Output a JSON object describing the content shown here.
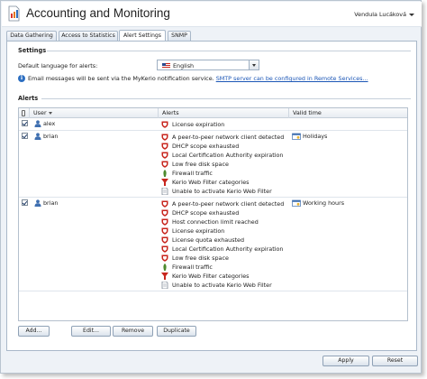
{
  "app": {
    "title": "Accounting and Monitoring",
    "user": "Vendula Lucáková"
  },
  "tabs": [
    {
      "label": "Data Gathering",
      "active": false
    },
    {
      "label": "Access to Statistics",
      "active": false
    },
    {
      "label": "Alert Settings",
      "active": true
    },
    {
      "label": "SNMP",
      "active": false
    }
  ],
  "settings": {
    "group_title": "Settings",
    "language_label": "Default language for alerts:",
    "language_value": "English",
    "info_text": "Email messages will be sent via the MyKerio notification service.",
    "info_link": "SMTP server can be configured in Remote Services..."
  },
  "alerts": {
    "group_title": "Alerts",
    "columns": {
      "user": "User",
      "alerts": "Alerts",
      "valid_time": "Valid time"
    },
    "rows": [
      {
        "user": "alex",
        "checked": true,
        "alerts": [
          "License expiration"
        ],
        "valid_time": ""
      },
      {
        "user": "brian",
        "checked": true,
        "alerts": [
          "A peer-to-peer network client detected",
          "DHCP scope exhausted",
          "Local Certification Authority expiration",
          "Low free disk space",
          "Firewall traffic",
          "Kerio Web Filter categories",
          "Unable to activate Kerio Web Filter"
        ],
        "valid_time": "Holidays"
      },
      {
        "user": "brian",
        "checked": true,
        "alerts": [
          "A peer-to-peer network client detected",
          "DHCP scope exhausted",
          "Host connection limit reached",
          "License expiration",
          "License quota exhausted",
          "Local Certification Authority expiration",
          "Low free disk space",
          "Firewall traffic",
          "Kerio Web Filter categories",
          "Unable to activate Kerio Web Filter"
        ],
        "valid_time": "Working hours"
      }
    ]
  },
  "buttons": {
    "add": "Add...",
    "edit": "Edit...",
    "remove": "Remove",
    "duplicate": "Duplicate"
  },
  "footer": {
    "apply": "Apply",
    "reset": "Reset"
  },
  "colors": {
    "accent": "#1b56b6",
    "alert_red": "#c8261e",
    "firewall_green": "#4d8a2e"
  }
}
